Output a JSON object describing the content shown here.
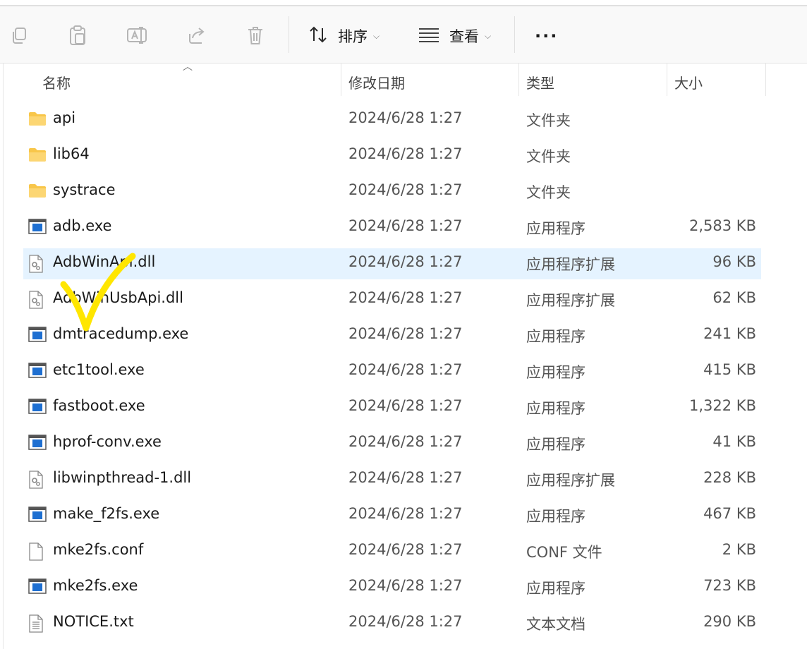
{
  "toolbar": {
    "icons": [
      "copy-icon",
      "paste-icon",
      "rename-icon",
      "share-icon",
      "delete-icon"
    ],
    "sort_label": "排序",
    "view_label": "查看",
    "more_label": "···"
  },
  "columns": {
    "name": "名称",
    "date": "修改日期",
    "type": "类型",
    "size": "大小"
  },
  "files": [
    {
      "name": "api",
      "date": "2024/6/28 1:27",
      "type": "文件夹",
      "size": "",
      "icon": "folder-icon"
    },
    {
      "name": "lib64",
      "date": "2024/6/28 1:27",
      "type": "文件夹",
      "size": "",
      "icon": "folder-icon"
    },
    {
      "name": "systrace",
      "date": "2024/6/28 1:27",
      "type": "文件夹",
      "size": "",
      "icon": "folder-icon"
    },
    {
      "name": "adb.exe",
      "date": "2024/6/28 1:27",
      "type": "应用程序",
      "size": "2,583 KB",
      "icon": "exe-icon"
    },
    {
      "name": "AdbWinApi.dll",
      "date": "2024/6/28 1:27",
      "type": "应用程序扩展",
      "size": "96 KB",
      "icon": "dll-icon",
      "selected": true
    },
    {
      "name": "AdbWinUsbApi.dll",
      "date": "2024/6/28 1:27",
      "type": "应用程序扩展",
      "size": "62 KB",
      "icon": "dll-icon"
    },
    {
      "name": "dmtracedump.exe",
      "date": "2024/6/28 1:27",
      "type": "应用程序",
      "size": "241 KB",
      "icon": "exe-icon"
    },
    {
      "name": "etc1tool.exe",
      "date": "2024/6/28 1:27",
      "type": "应用程序",
      "size": "415 KB",
      "icon": "exe-icon"
    },
    {
      "name": "fastboot.exe",
      "date": "2024/6/28 1:27",
      "type": "应用程序",
      "size": "1,322 KB",
      "icon": "exe-icon"
    },
    {
      "name": "hprof-conv.exe",
      "date": "2024/6/28 1:27",
      "type": "应用程序",
      "size": "41 KB",
      "icon": "exe-icon"
    },
    {
      "name": "libwinpthread-1.dll",
      "date": "2024/6/28 1:27",
      "type": "应用程序扩展",
      "size": "228 KB",
      "icon": "dll-icon"
    },
    {
      "name": "make_f2fs.exe",
      "date": "2024/6/28 1:27",
      "type": "应用程序",
      "size": "467 KB",
      "icon": "exe-icon"
    },
    {
      "name": "mke2fs.conf",
      "date": "2024/6/28 1:27",
      "type": "CONF 文件",
      "size": "2 KB",
      "icon": "file-icon"
    },
    {
      "name": "mke2fs.exe",
      "date": "2024/6/28 1:27",
      "type": "应用程序",
      "size": "723 KB",
      "icon": "exe-icon"
    },
    {
      "name": "NOTICE.txt",
      "date": "2024/6/28 1:27",
      "type": "文本文档",
      "size": "290 KB",
      "icon": "text-file-icon"
    }
  ],
  "colors": {
    "selection": "#e5f3ff",
    "folder": "#f8c64a",
    "exe_blue": "#1e6fd1",
    "annotation": "#ffe600"
  }
}
